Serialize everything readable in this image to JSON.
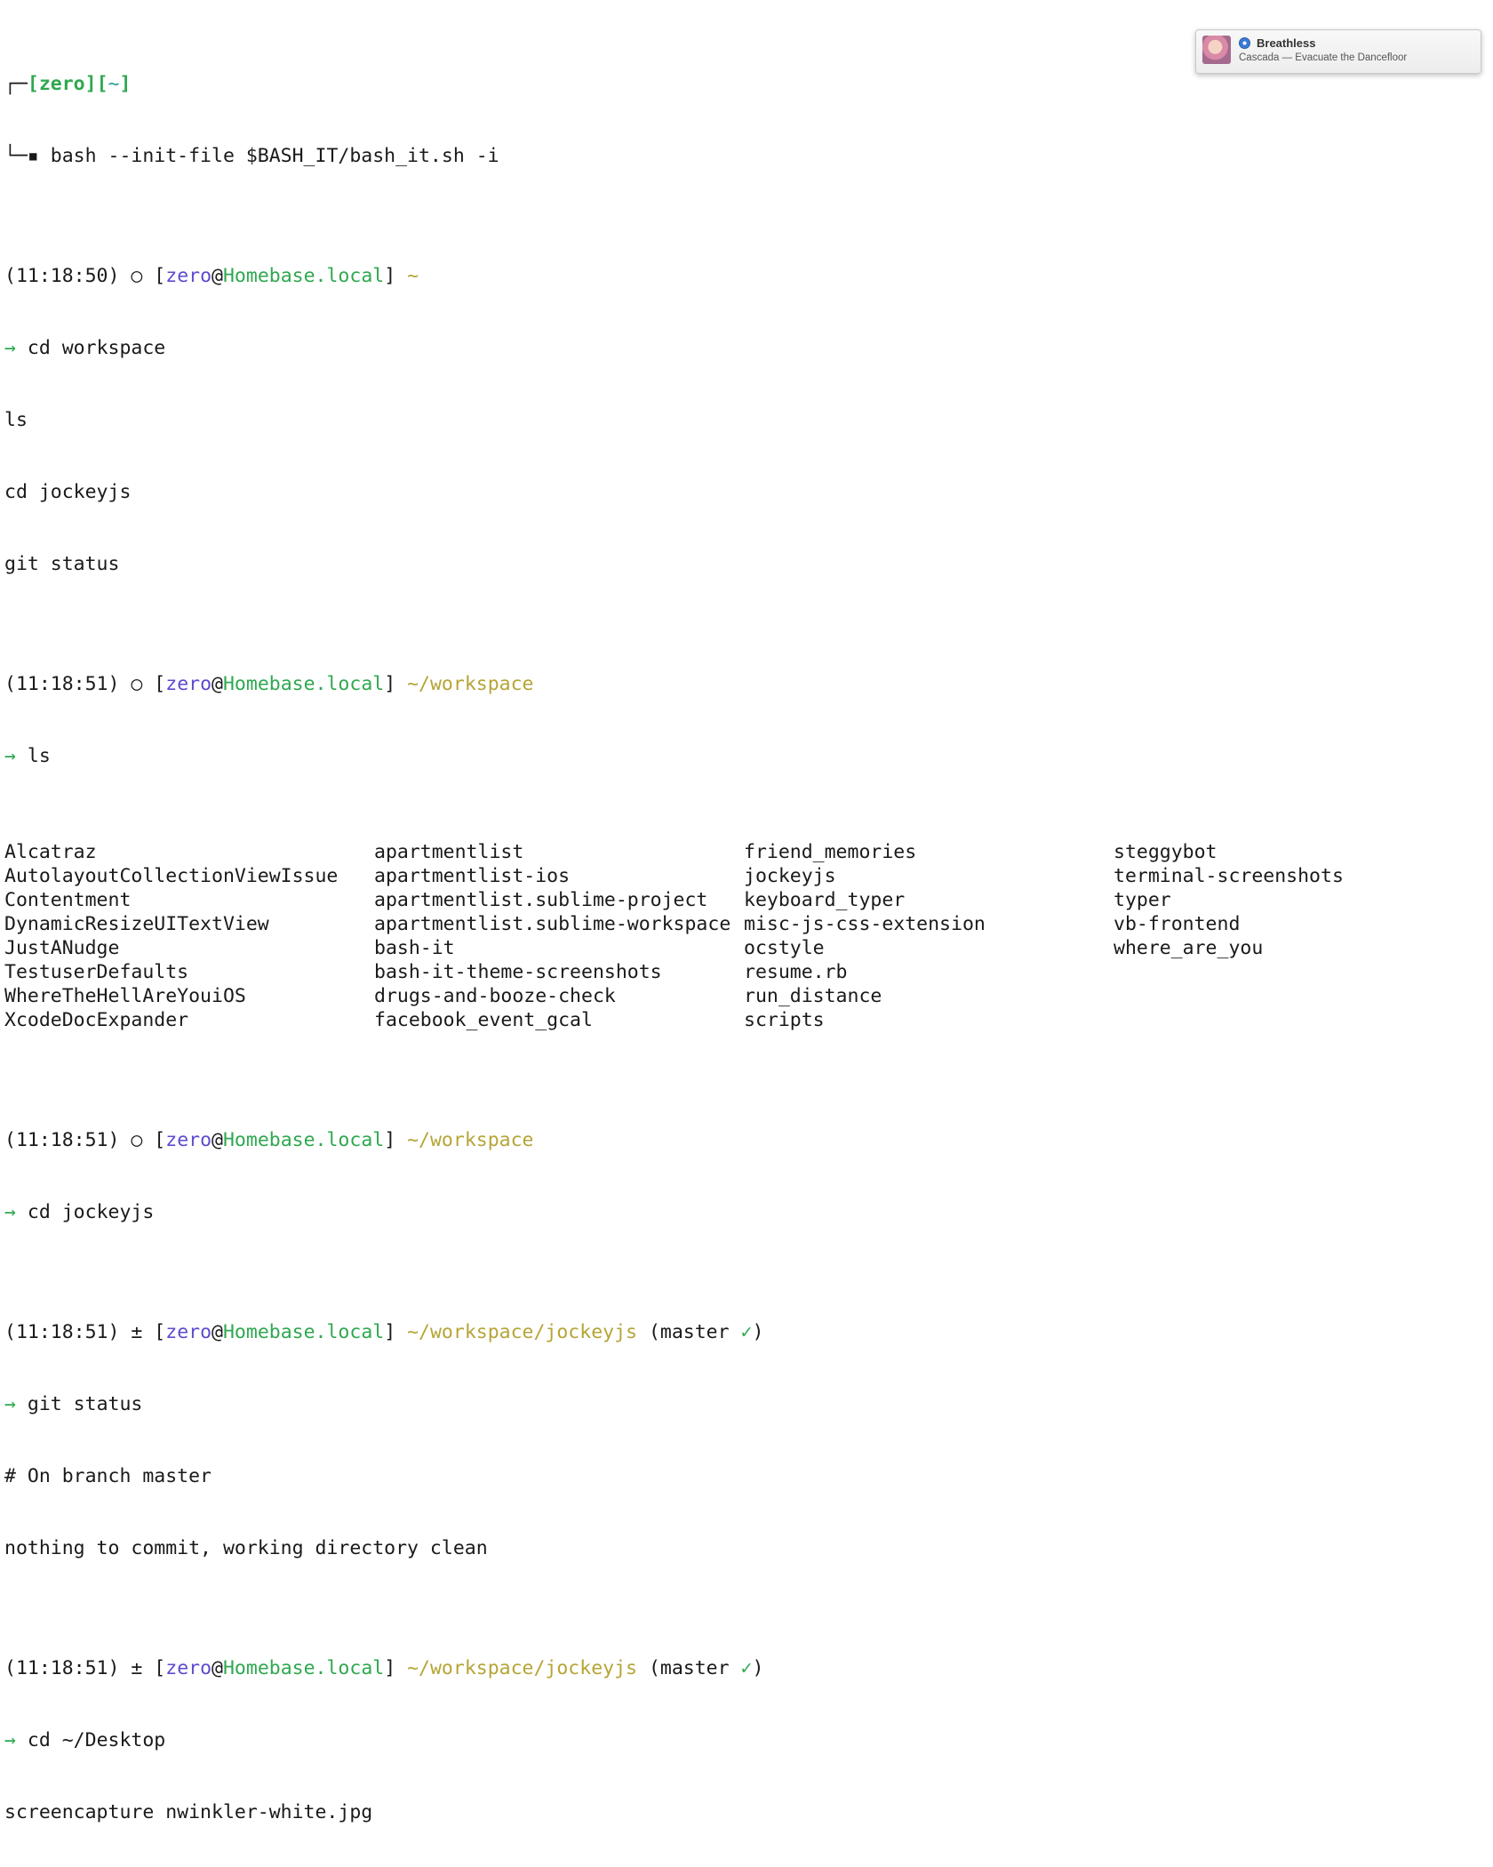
{
  "terminal": {
    "header": {
      "corner_top": "┌─",
      "bracket_open": "[",
      "user": "zero",
      "bracket_mid": "][",
      "home": "~",
      "bracket_close": "]",
      "corner_bottom": "└─▪ ",
      "command": "bash --init-file $BASH_IT/bash_it.sh -i"
    },
    "prompts": [
      {
        "time": "(11:18:50)",
        "symbol": "○",
        "user": "zero",
        "at": "@",
        "host": "Homebase.local",
        "path": "~",
        "branch_open": "",
        "check": "",
        "branch_close": ""
      },
      {
        "time": "(11:18:51)",
        "symbol": "○",
        "user": "zero",
        "at": "@",
        "host": "Homebase.local",
        "path": "~/workspace",
        "branch_open": "",
        "check": "",
        "branch_close": ""
      },
      {
        "time": "(11:18:51)",
        "symbol": "○",
        "user": "zero",
        "at": "@",
        "host": "Homebase.local",
        "path": "~/workspace",
        "branch_open": "",
        "check": "",
        "branch_close": ""
      },
      {
        "time": "(11:18:51)",
        "symbol": "±",
        "user": "zero",
        "at": "@",
        "host": "Homebase.local",
        "path": "~/workspace/jockeyjs",
        "branch_open": "(master ",
        "check": "✓",
        "branch_close": ")"
      },
      {
        "time": "(11:18:51)",
        "symbol": "±",
        "user": "zero",
        "at": "@",
        "host": "Homebase.local",
        "path": "~/workspace/jockeyjs",
        "branch_open": "(master ",
        "check": "✓",
        "branch_close": ")"
      }
    ],
    "arrow": "→",
    "commands": {
      "c1": "cd workspace",
      "typeahead1": "ls",
      "typeahead2": "cd jockeyjs",
      "typeahead3": "git status",
      "c2": "ls",
      "c3": "cd jockeyjs",
      "c4": "git status",
      "c5": "cd ~/Desktop",
      "typeahead4": "screencapture nwinkler-white.jpg"
    },
    "ls_output": [
      "Alcatraz",
      "apartmentlist",
      "friend_memories",
      "steggybot",
      "AutolayoutCollectionViewIssue",
      "apartmentlist-ios",
      "jockeyjs",
      "terminal-screenshots",
      "Contentment",
      "apartmentlist.sublime-project",
      "keyboard_typer",
      "typer",
      "DynamicResizeUITextView",
      "apartmentlist.sublime-workspace",
      "misc-js-css-extension",
      "vb-frontend",
      "JustANudge",
      "bash-it",
      "ocstyle",
      "where_are_you",
      "TestuserDefaults",
      "bash-it-theme-screenshots",
      "resume.rb",
      "",
      "WhereTheHellAreYouiOS",
      "drugs-and-booze-check",
      "run_distance",
      "",
      "XcodeDocExpander",
      "facebook_event_gcal",
      "scripts",
      ""
    ],
    "git_output": [
      "# On branch master",
      "nothing to commit, working directory clean"
    ]
  },
  "notification": {
    "title": "Breathless",
    "subtitle": "Cascada — Evacuate the Dancefloor",
    "app_icon": "itunes-icon",
    "thumbnail": "album-art"
  }
}
